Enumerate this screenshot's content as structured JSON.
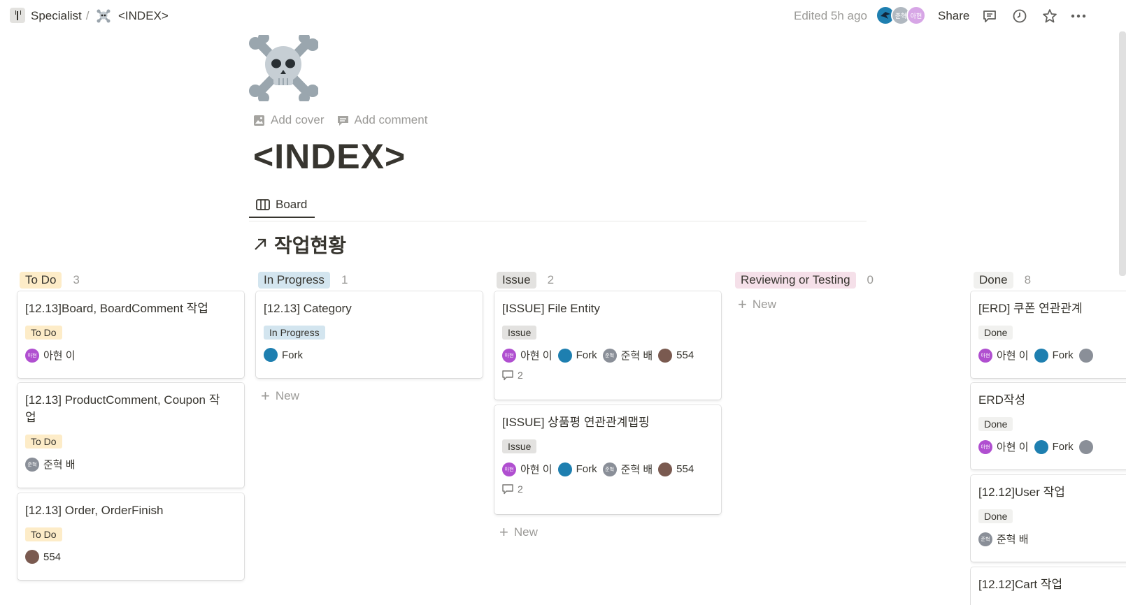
{
  "breadcrumb": {
    "workspace": "Specialist",
    "separator": "/",
    "page": "<INDEX>"
  },
  "topbar": {
    "edited": "Edited 5h ago",
    "avatars": [
      "준혁",
      "아현"
    ],
    "share": "Share",
    "icons": [
      "comment-icon",
      "clock-icon",
      "star-icon",
      "more-icon"
    ]
  },
  "page": {
    "icon": "skull-and-crossbones",
    "add_cover": "Add cover",
    "add_comment": "Add comment",
    "title": "<INDEX>"
  },
  "views": {
    "board_tab": "Board"
  },
  "database": {
    "title": "작업현황",
    "new_label": "New"
  },
  "columns": [
    {
      "name": "To Do",
      "count": "3",
      "color": "#fdecc8",
      "cards": [
        {
          "title": "[12.13]Board, BoardComment 작업",
          "tag": "To Do",
          "people": [
            {
              "name": "아현 이",
              "avatar": "아현"
            }
          ]
        },
        {
          "title": "[12.13] ProductComment, Coupon 작업",
          "tag": "To Do",
          "people": [
            {
              "name": "준혁 배",
              "avatar": "준혁"
            }
          ]
        },
        {
          "title": "[12.13] Order, OrderFinish",
          "tag": "To Do",
          "people": [
            {
              "name": "554",
              "avatar": ""
            }
          ]
        }
      ]
    },
    {
      "name": "In Progress",
      "count": "1",
      "color": "#d3e5ef",
      "cards": [
        {
          "title": "[12.13] Category",
          "tag": "In Progress",
          "people": [
            {
              "name": "Fork",
              "avatar": ""
            }
          ]
        }
      ]
    },
    {
      "name": "Issue",
      "count": "2",
      "color": "#e3e2e0",
      "cards": [
        {
          "title": "[ISSUE] File Entity",
          "tag": "Issue",
          "people": [
            {
              "name": "아현 이",
              "avatar": "아현"
            },
            {
              "name": "Fork",
              "avatar": ""
            },
            {
              "name": "준혁 배",
              "avatar": "준혁"
            },
            {
              "name": "554",
              "avatar": ""
            }
          ],
          "comments": "2"
        },
        {
          "title": "[ISSUE] 상품평 연관관계맵핑",
          "tag": "Issue",
          "people": [
            {
              "name": "아현 이",
              "avatar": "아현"
            },
            {
              "name": "Fork",
              "avatar": ""
            },
            {
              "name": "준혁 배",
              "avatar": "준혁"
            },
            {
              "name": "554",
              "avatar": ""
            }
          ],
          "comments": "2"
        }
      ]
    },
    {
      "name": "Reviewing or Testing",
      "count": "0",
      "color": "#f5e0e9",
      "cards": []
    },
    {
      "name": "Done",
      "count": "8",
      "color": "#f1f1ef",
      "cards": [
        {
          "title": "[ERD] 쿠폰 연관관계",
          "tag": "Done",
          "people": [
            {
              "name": "아현 이",
              "avatar": "아현"
            },
            {
              "name": "Fork",
              "avatar": ""
            }
          ]
        },
        {
          "title": "ERD작성",
          "tag": "Done",
          "people": [
            {
              "name": "아현 이",
              "avatar": "아현"
            },
            {
              "name": "Fork",
              "avatar": ""
            }
          ]
        },
        {
          "title": "[12.12]User 작업",
          "tag": "Done",
          "people": [
            {
              "name": "준혁 배",
              "avatar": "준혁"
            }
          ]
        },
        {
          "title": "[12.12]Cart 작업"
        }
      ]
    }
  ]
}
